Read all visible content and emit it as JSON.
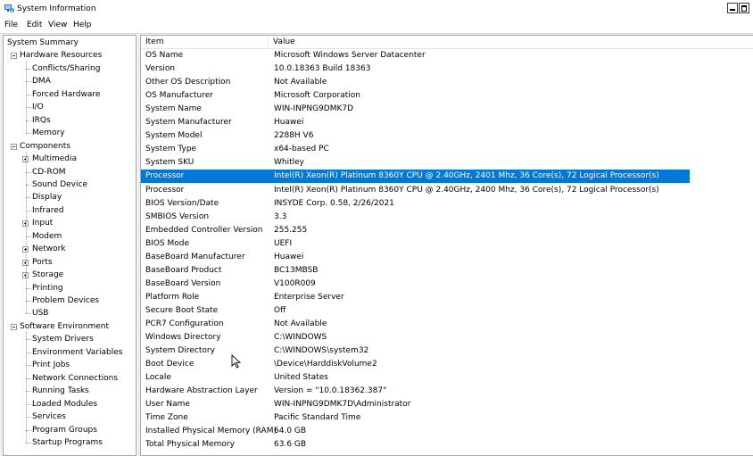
{
  "window": {
    "title": "System Information"
  },
  "menu": [
    "File",
    "Edit",
    "View",
    "Help"
  ],
  "tree": [
    {
      "label": "System Summary",
      "level": 0,
      "expander": "none"
    },
    {
      "label": "Hardware Resources",
      "level": 0,
      "expander": "minus"
    },
    {
      "label": "Conflicts/Sharing",
      "level": 1,
      "expander": "none"
    },
    {
      "label": "DMA",
      "level": 1,
      "expander": "none"
    },
    {
      "label": "Forced Hardware",
      "level": 1,
      "expander": "none"
    },
    {
      "label": "I/O",
      "level": 1,
      "expander": "none"
    },
    {
      "label": "IRQs",
      "level": 1,
      "expander": "none"
    },
    {
      "label": "Memory",
      "level": 1,
      "expander": "none"
    },
    {
      "label": "Components",
      "level": 0,
      "expander": "minus"
    },
    {
      "label": "Multimedia",
      "level": 1,
      "expander": "plus"
    },
    {
      "label": "CD-ROM",
      "level": 1,
      "expander": "none"
    },
    {
      "label": "Sound Device",
      "level": 1,
      "expander": "none"
    },
    {
      "label": "Display",
      "level": 1,
      "expander": "none"
    },
    {
      "label": "Infrared",
      "level": 1,
      "expander": "none"
    },
    {
      "label": "Input",
      "level": 1,
      "expander": "plus"
    },
    {
      "label": "Modem",
      "level": 1,
      "expander": "none"
    },
    {
      "label": "Network",
      "level": 1,
      "expander": "plus"
    },
    {
      "label": "Ports",
      "level": 1,
      "expander": "plus"
    },
    {
      "label": "Storage",
      "level": 1,
      "expander": "plus"
    },
    {
      "label": "Printing",
      "level": 1,
      "expander": "none"
    },
    {
      "label": "Problem Devices",
      "level": 1,
      "expander": "none"
    },
    {
      "label": "USB",
      "level": 1,
      "expander": "none"
    },
    {
      "label": "Software Environment",
      "level": 0,
      "expander": "minus"
    },
    {
      "label": "System Drivers",
      "level": 1,
      "expander": "none"
    },
    {
      "label": "Environment Variables",
      "level": 1,
      "expander": "none"
    },
    {
      "label": "Print Jobs",
      "level": 1,
      "expander": "none"
    },
    {
      "label": "Network Connections",
      "level": 1,
      "expander": "none"
    },
    {
      "label": "Running Tasks",
      "level": 1,
      "expander": "none"
    },
    {
      "label": "Loaded Modules",
      "level": 1,
      "expander": "none"
    },
    {
      "label": "Services",
      "level": 1,
      "expander": "none"
    },
    {
      "label": "Program Groups",
      "level": 1,
      "expander": "none"
    },
    {
      "label": "Startup Programs",
      "level": 1,
      "expander": "none"
    }
  ],
  "list": {
    "headers": {
      "item": "Item",
      "value": "Value"
    },
    "selected_index": 10,
    "rows": [
      {
        "item": "OS Name",
        "value": "Microsoft Windows Server Datacenter"
      },
      {
        "item": "Version",
        "value": "10.0.18363 Build 18363"
      },
      {
        "item": "Other OS Description",
        "value": "Not Available"
      },
      {
        "item": "OS Manufacturer",
        "value": "Microsoft Corporation"
      },
      {
        "item": "System Name",
        "value": "WIN-INPNG9DMK7D"
      },
      {
        "item": "System Manufacturer",
        "value": "Huawei"
      },
      {
        "item": "System Model",
        "value": "2288H V6"
      },
      {
        "item": "System Type",
        "value": "x64-based PC"
      },
      {
        "item": "System SKU",
        "value": "Whitley"
      },
      {
        "item": "Processor",
        "value": "Intel(R) Xeon(R) Platinum 8360Y CPU @ 2.40GHz, 2401 Mhz, 36 Core(s), 72 Logical Processor(s)"
      },
      {
        "item": "Processor",
        "value": "Intel(R) Xeon(R) Platinum 8360Y CPU @ 2.40GHz, 2400 Mhz, 36 Core(s), 72 Logical Processor(s)"
      },
      {
        "item": "BIOS Version/Date",
        "value": "INSYDE Corp. 0.58, 2/26/2021"
      },
      {
        "item": "SMBIOS Version",
        "value": "3.3"
      },
      {
        "item": "Embedded Controller Version",
        "value": "255.255"
      },
      {
        "item": "BIOS Mode",
        "value": "UEFI"
      },
      {
        "item": "BaseBoard Manufacturer",
        "value": "Huawei"
      },
      {
        "item": "BaseBoard Product",
        "value": "BC13MBSB"
      },
      {
        "item": "BaseBoard Version",
        "value": "V100R009"
      },
      {
        "item": "Platform Role",
        "value": "Enterprise Server"
      },
      {
        "item": "Secure Boot State",
        "value": "Off"
      },
      {
        "item": "PCR7 Configuration",
        "value": "Not Available"
      },
      {
        "item": "Windows Directory",
        "value": "C:\\WINDOWS"
      },
      {
        "item": "System Directory",
        "value": "C:\\WINDOWS\\system32"
      },
      {
        "item": "Boot Device",
        "value": "\\Device\\HarddiskVolume2"
      },
      {
        "item": "Locale",
        "value": "United States"
      },
      {
        "item": "Hardware Abstraction Layer",
        "value": "Version = \"10.0.18362.387\""
      },
      {
        "item": "User Name",
        "value": "WIN-INPNG9DMK7D\\Administrator"
      },
      {
        "item": "Time Zone",
        "value": "Pacific Standard Time"
      },
      {
        "item": "Installed Physical Memory (RAM)",
        "value": "64.0 GB"
      },
      {
        "item": "Total Physical Memory",
        "value": "63.6 GB"
      }
    ]
  },
  "colors": {
    "selection": "#0078d7",
    "pane_border": "#a8a8a8"
  }
}
